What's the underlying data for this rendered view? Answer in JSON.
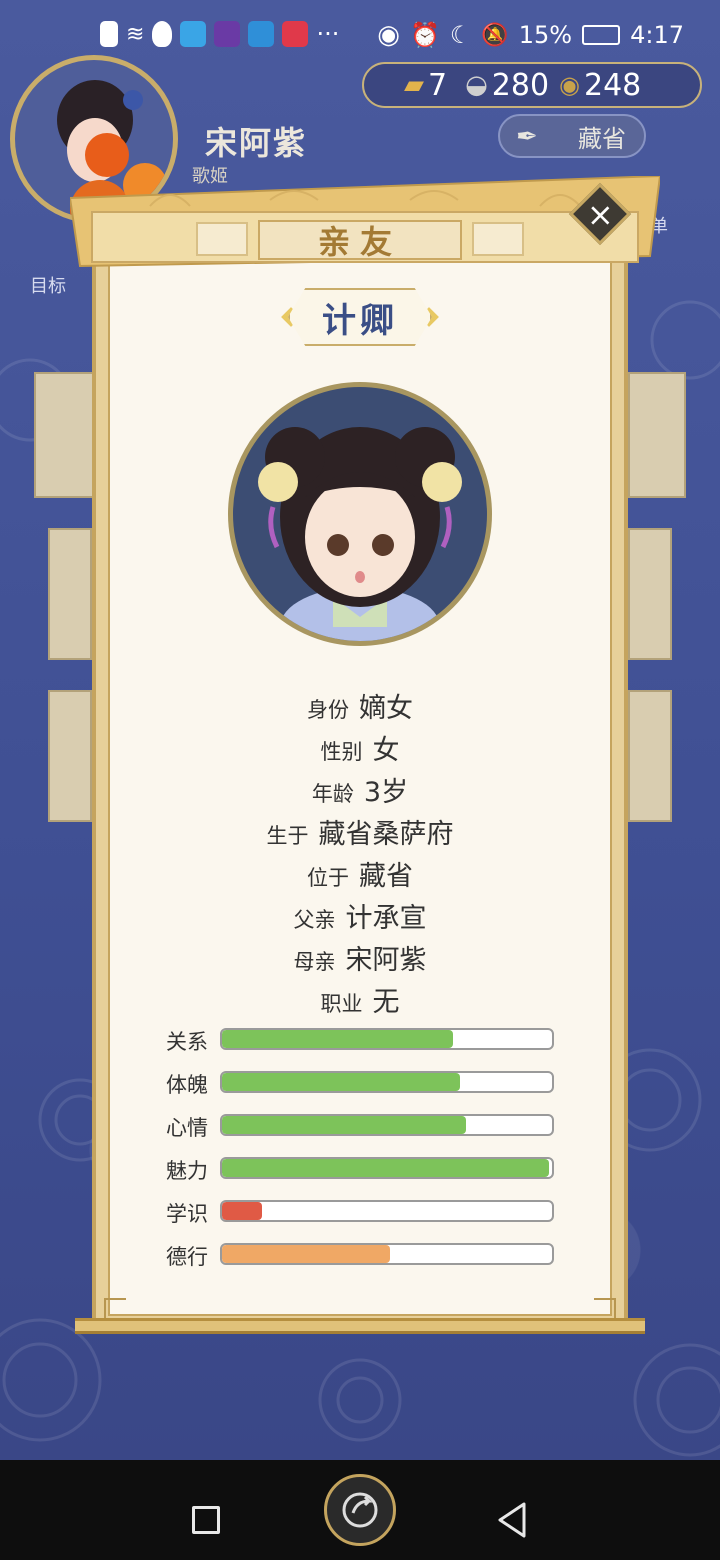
{
  "status_bar": {
    "battery": "15%",
    "time": "4:17"
  },
  "hud": {
    "player_name": "宋阿紫",
    "player_title": "歌姬",
    "currency": {
      "gold": "7",
      "silver": "280",
      "coins": "248"
    },
    "location_button": "藏省",
    "goal_label": "目标",
    "menu_label": "菜单"
  },
  "dialog": {
    "tab_title": "亲友",
    "close_label": "×",
    "character_name": "计卿",
    "info": [
      {
        "key": "身份",
        "value": "嫡女"
      },
      {
        "key": "性别",
        "value": "女"
      },
      {
        "key": "年龄",
        "value": "3岁"
      },
      {
        "key": "生于",
        "value": "藏省桑萨府"
      },
      {
        "key": "位于",
        "value": "藏省"
      },
      {
        "key": "父亲",
        "value": "计承宣"
      },
      {
        "key": "母亲",
        "value": "宋阿紫"
      },
      {
        "key": "职业",
        "value": "无"
      }
    ],
    "stats": [
      {
        "label": "关系",
        "level": 0.7,
        "color": "#7dc35a"
      },
      {
        "label": "体魄",
        "level": 0.72,
        "color": "#7dc35a"
      },
      {
        "label": "心情",
        "level": 0.74,
        "color": "#7dc35a"
      },
      {
        "label": "魅力",
        "level": 0.99,
        "color": "#7dc35a"
      },
      {
        "label": "学识",
        "level": 0.12,
        "color": "#e05a45"
      },
      {
        "label": "德行",
        "level": 0.51,
        "color": "#f0a865"
      }
    ]
  }
}
